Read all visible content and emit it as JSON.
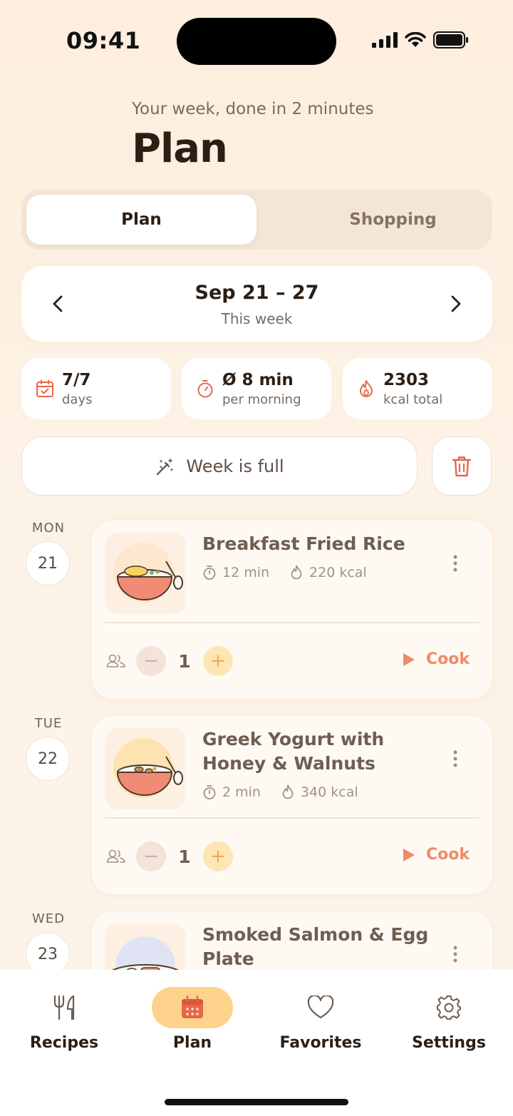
{
  "status_bar": {
    "time": "09:41"
  },
  "header": {
    "subtitle": "Your week, done in 2 minutes",
    "title": "Plan"
  },
  "segmented": {
    "tabs": [
      "Plan",
      "Shopping"
    ],
    "selected": "Plan"
  },
  "week_nav": {
    "range": "Sep 21 – 27",
    "relative": "This week"
  },
  "stats": [
    {
      "icon": "calendar-check-icon",
      "value": "7/7",
      "label": "days"
    },
    {
      "icon": "timer-icon",
      "value": "Ø 8 min",
      "label": "per morning"
    },
    {
      "icon": "flame-icon",
      "value": "2303",
      "label": "kcal total"
    }
  ],
  "actions": {
    "fill_week_label": "Week is full"
  },
  "days": [
    {
      "day": "MON",
      "date": "21",
      "meal": {
        "name": "Breakfast Fried Rice",
        "time": "12 min",
        "kcal": "220 kcal",
        "servings": "1",
        "cook_label": "Cook"
      }
    },
    {
      "day": "TUE",
      "date": "22",
      "meal": {
        "name": "Greek Yogurt with Honey & Walnuts",
        "time": "2 min",
        "kcal": "340 kcal",
        "servings": "1",
        "cook_label": "Cook"
      }
    },
    {
      "day": "WED",
      "date": "23",
      "meal": {
        "name": "Smoked Salmon & Egg Plate"
      }
    }
  ],
  "bottom_nav": [
    {
      "label": "Recipes",
      "icon": "fork-knife-icon"
    },
    {
      "label": "Plan",
      "icon": "calendar-icon",
      "active": true
    },
    {
      "label": "Favorites",
      "icon": "heart-icon"
    },
    {
      "label": "Settings",
      "icon": "gear-icon"
    }
  ],
  "colors": {
    "accent": "#f08a68",
    "active_nav": "#fdd38c",
    "background": "#fdf0e2"
  }
}
